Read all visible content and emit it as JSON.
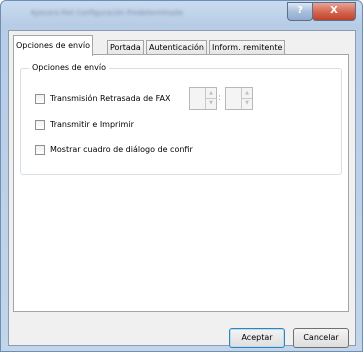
{
  "window": {
    "title": "Kyocera FAX Configuración Predeterminada",
    "help_label": "?",
    "close_label": "X"
  },
  "tabs": [
    {
      "label": "Opciones de envío",
      "active": true
    },
    {
      "label": "Portada",
      "active": false
    },
    {
      "label": "Autenticación",
      "active": false
    },
    {
      "label": "Inform. remitente",
      "active": false
    }
  ],
  "group": {
    "title": "Opciones de envío",
    "options": [
      {
        "label": "Transmisión Retrasada de FAX",
        "checked": false
      },
      {
        "label": "Transmitir e Imprimir",
        "checked": false
      },
      {
        "label": "Mostrar cuadro de diálogo de confir",
        "checked": false
      }
    ],
    "time_separator": ":",
    "hour_value": "",
    "minute_value": ""
  },
  "buttons": {
    "accept": "Aceptar",
    "cancel": "Cancelar"
  }
}
